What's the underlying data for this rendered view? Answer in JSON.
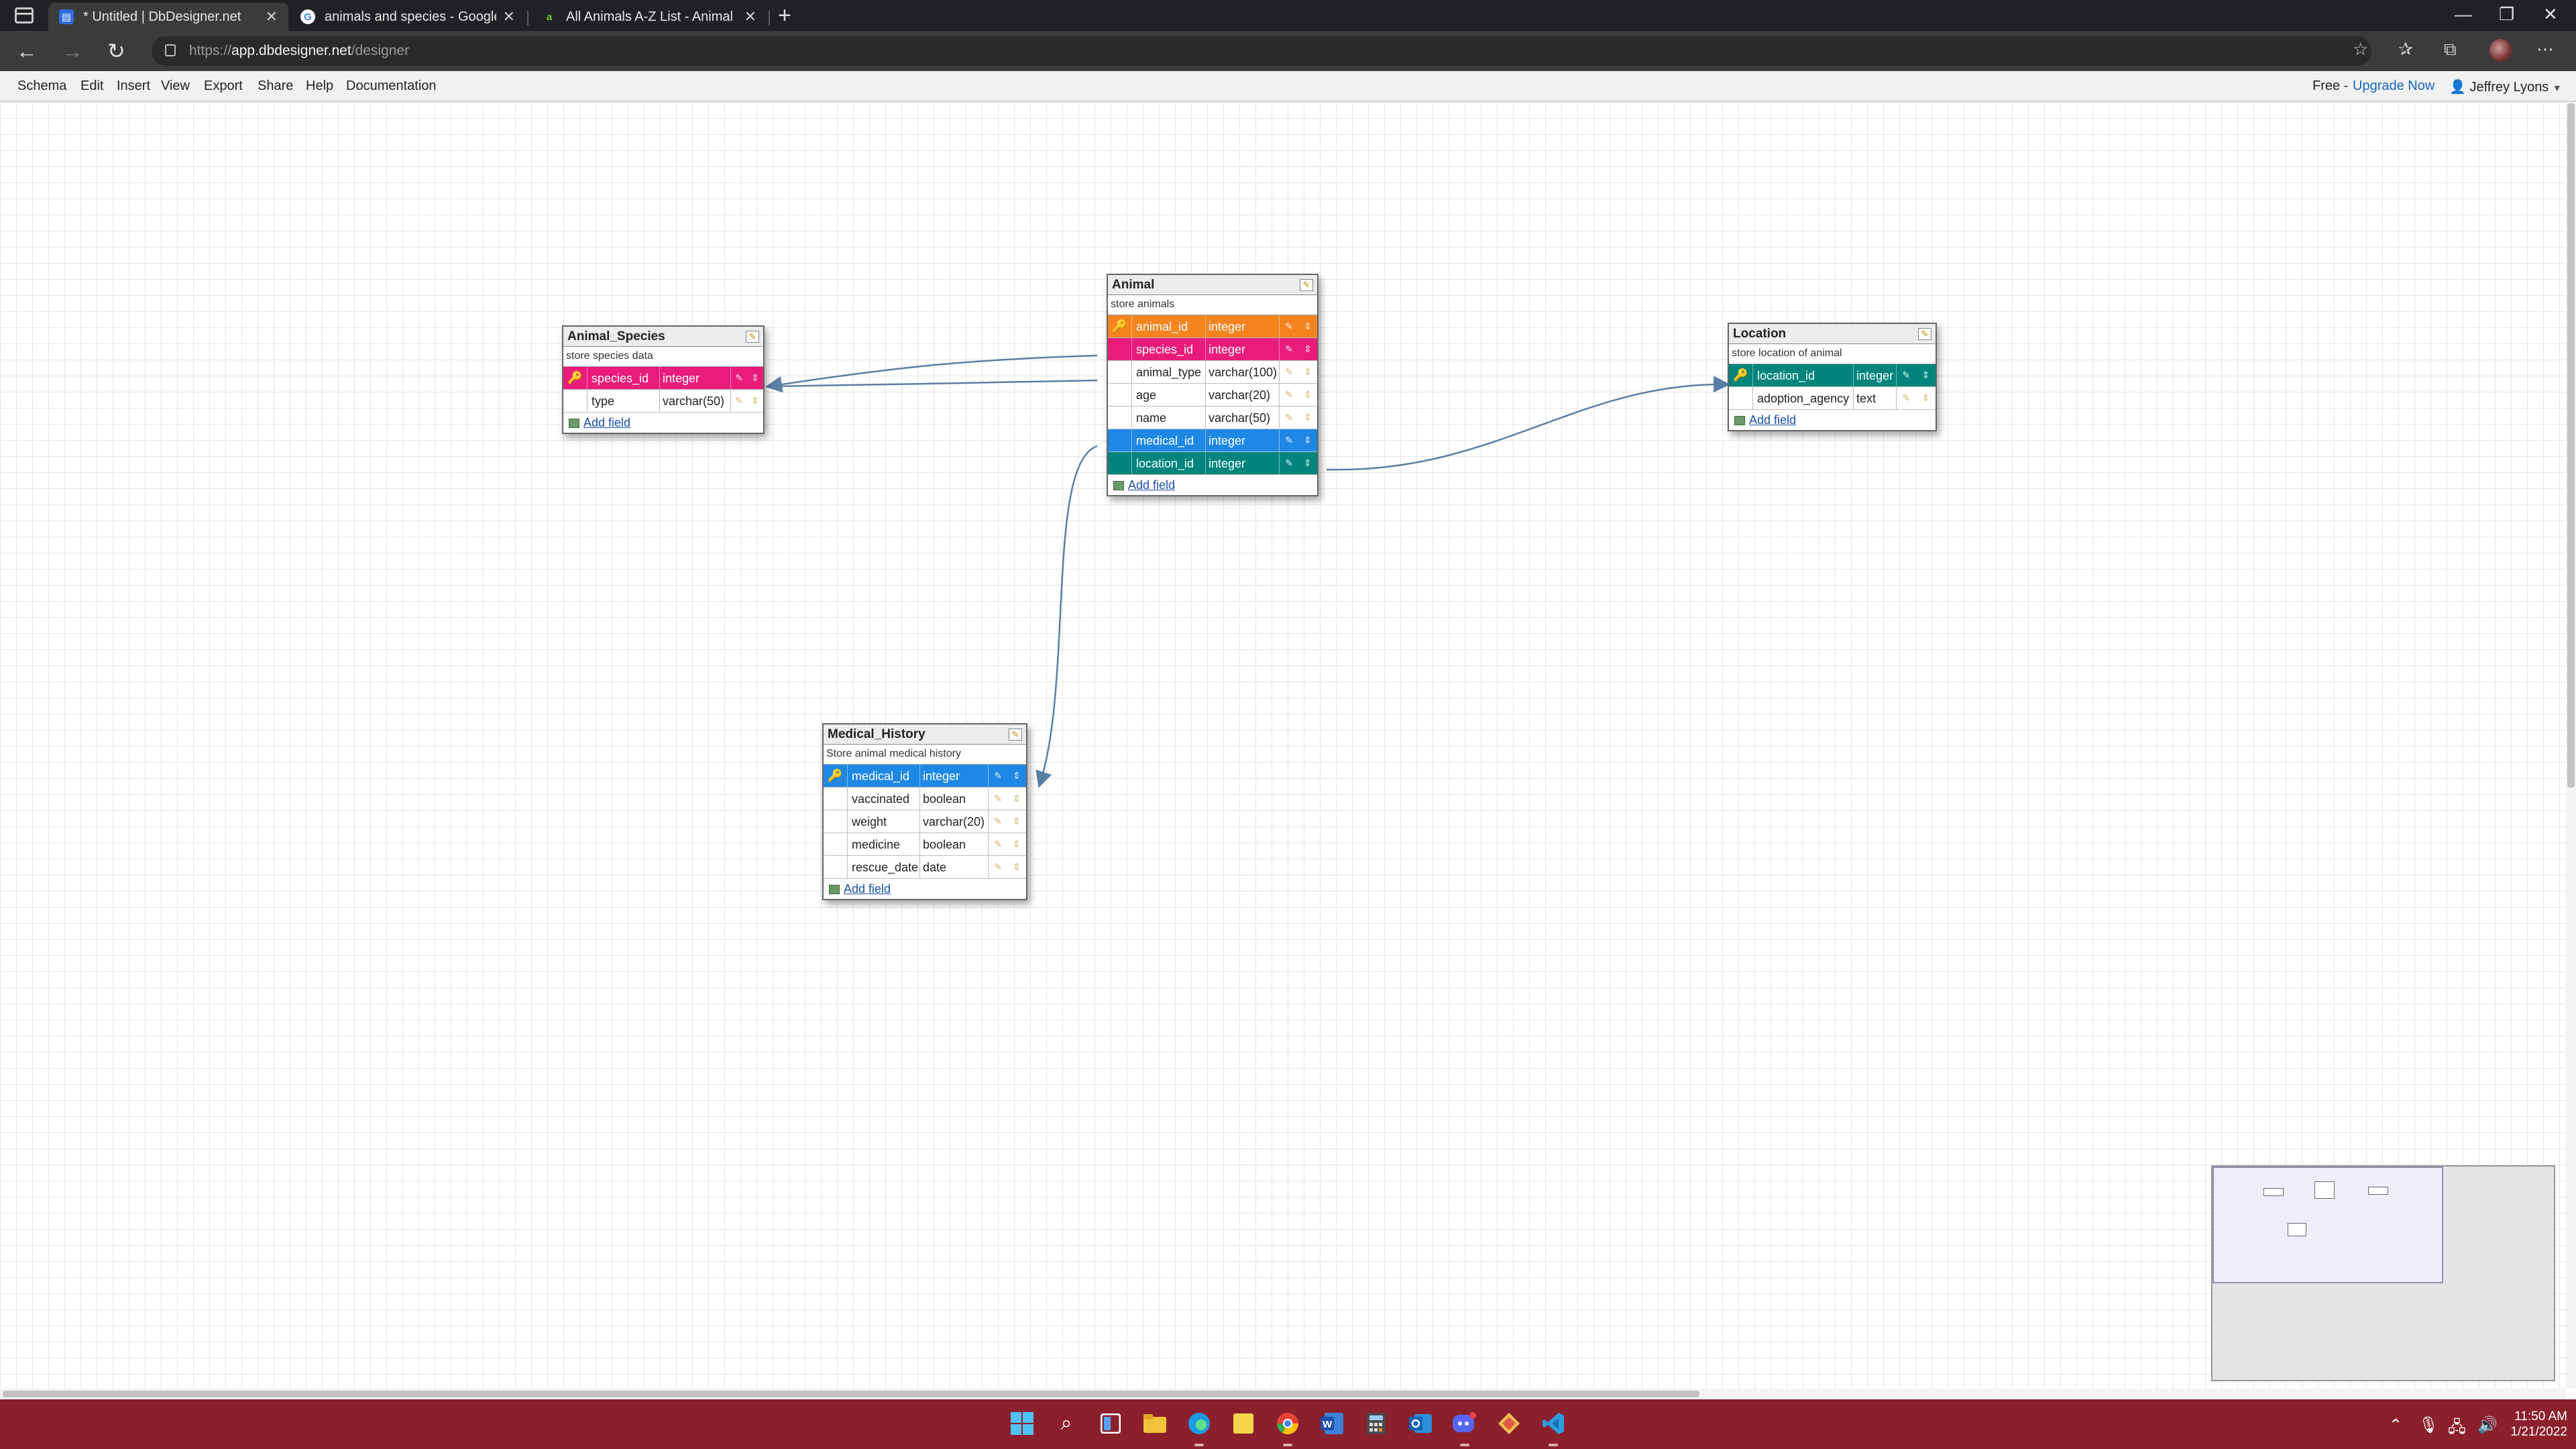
{
  "browser": {
    "tabs": [
      {
        "title": "* Untitled | DbDesigner.net",
        "active": true
      },
      {
        "title": "animals and species - Google Se",
        "active": false
      },
      {
        "title": "All Animals A-Z List - Animal Na",
        "active": false
      }
    ],
    "new_tab_glyph": "+",
    "url_scheme": "https://",
    "url_host": "app.dbdesigner.net",
    "url_path": "/designer"
  },
  "menu": {
    "items": [
      "Schema",
      "Edit",
      "Insert",
      "View",
      "Export",
      "Share",
      "Help",
      "Documentation"
    ],
    "plan": "Free -",
    "upgrade": "Upgrade Now",
    "user": "Jeffrey Lyons"
  },
  "tables": {
    "animal_species": {
      "name": "Animal_Species",
      "description": "store species data",
      "fields": [
        {
          "name": "species_id",
          "type": "integer",
          "key": true
        },
        {
          "name": "type",
          "type": "varchar(50)",
          "key": false
        }
      ],
      "add_field": "Add field"
    },
    "animal": {
      "name": "Animal",
      "description": "store animals",
      "fields": [
        {
          "name": "animal_id",
          "type": "integer",
          "key": true
        },
        {
          "name": "species_id",
          "type": "integer",
          "key": false
        },
        {
          "name": "animal_type",
          "type": "varchar(100)",
          "key": false
        },
        {
          "name": "age",
          "type": "varchar(20)",
          "key": false
        },
        {
          "name": "name",
          "type": "varchar(50)",
          "key": false
        },
        {
          "name": "medical_id",
          "type": "integer",
          "key": false
        },
        {
          "name": "location_id",
          "type": "integer",
          "key": false
        }
      ],
      "add_field": "Add field"
    },
    "location": {
      "name": "Location",
      "description": "store location of animal",
      "fields": [
        {
          "name": "location_id",
          "type": "integer",
          "key": true
        },
        {
          "name": "adoption_agency",
          "type": "text",
          "key": false
        }
      ],
      "add_field": "Add field"
    },
    "medical_history": {
      "name": "Medical_History",
      "description": "Store animal medical history",
      "fields": [
        {
          "name": "medical_id",
          "type": "integer",
          "key": true
        },
        {
          "name": "vaccinated",
          "type": "boolean",
          "key": false
        },
        {
          "name": "weight",
          "type": "varchar(20)",
          "key": false
        },
        {
          "name": "medicine",
          "type": "boolean",
          "key": false
        },
        {
          "name": "rescue_date",
          "type": "date",
          "key": false
        }
      ],
      "add_field": "Add field"
    }
  },
  "colors": {
    "orange": "#f5841f",
    "pink": "#ea1c7a",
    "blue": "#1e88e5",
    "teal": "#00857d",
    "connector": "#5a7fa6",
    "taskbar": "#8b1f2c"
  },
  "icons": {
    "primary_key": "key-icon",
    "edit_field": "pencil-icon",
    "move_field": "drag-handle-icon",
    "table_edit": "edit-table-icon"
  },
  "taskbar": {
    "time": "11:50 AM",
    "date": "1/21/2022"
  }
}
